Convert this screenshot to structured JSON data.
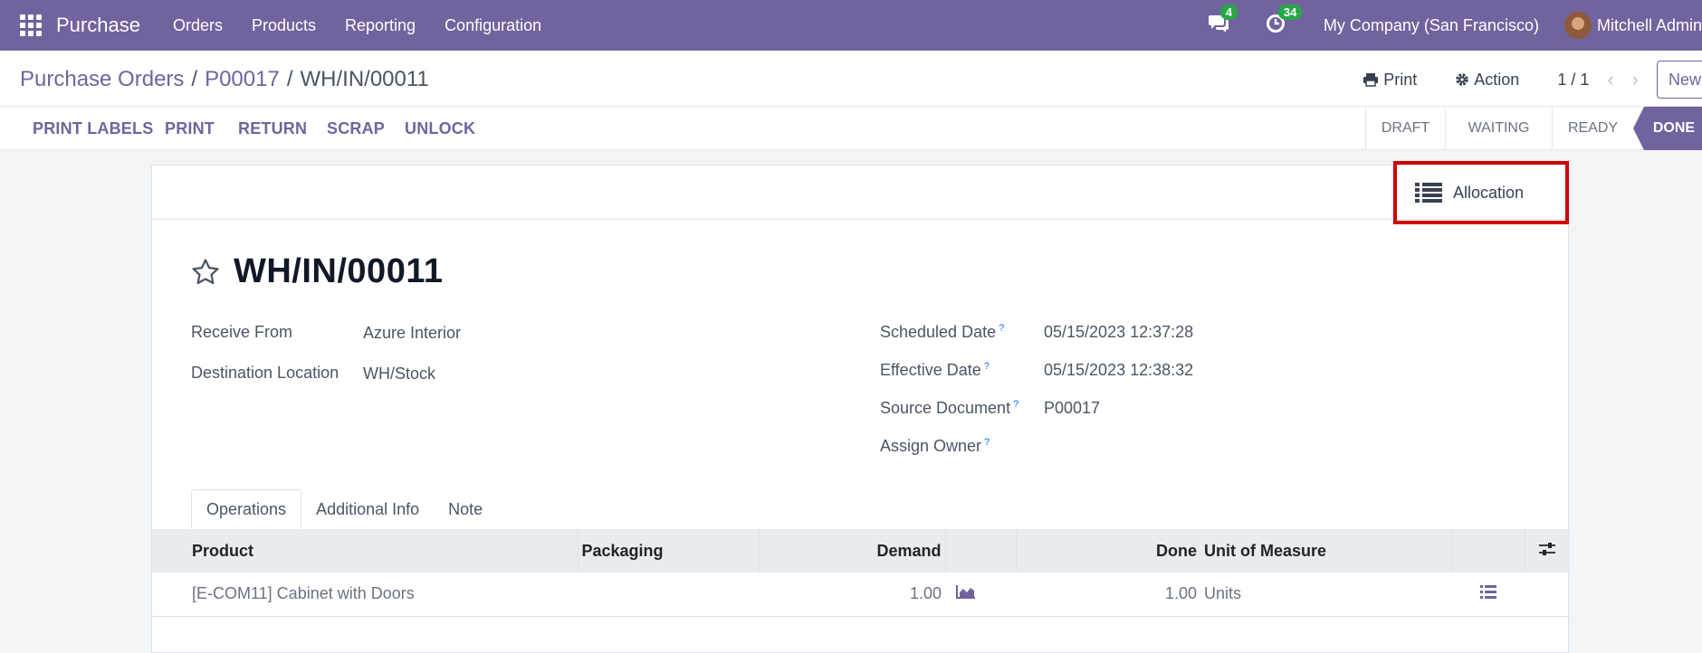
{
  "topnav": {
    "app_name": "Purchase",
    "menu": [
      "Orders",
      "Products",
      "Reporting",
      "Configuration"
    ],
    "messages_count": "4",
    "activities_count": "34",
    "company": "My Company (San Francisco)",
    "user": "Mitchell Admin"
  },
  "breadcrumb": {
    "items": [
      "Purchase Orders",
      "P00017"
    ],
    "current": "WH/IN/00011",
    "separator": "/"
  },
  "control": {
    "print_label": "Print",
    "action_label": "Action",
    "pager": "1 / 1",
    "new_label": "New"
  },
  "statusbar": {
    "buttons": [
      "PRINT LABELS",
      "PRINT",
      "RETURN",
      "SCRAP",
      "UNLOCK"
    ],
    "stages": [
      "DRAFT",
      "WAITING",
      "READY",
      "DONE"
    ],
    "active_stage": "DONE"
  },
  "smart_button": {
    "label": "Allocation"
  },
  "record": {
    "name": "WH/IN/00011",
    "receive_from_label": "Receive From",
    "receive_from": "Azure Interior",
    "destination_label": "Destination Location",
    "destination": "WH/Stock",
    "scheduled_label": "Scheduled Date",
    "scheduled": "05/15/2023 12:37:28",
    "effective_label": "Effective Date",
    "effective": "05/15/2023 12:38:32",
    "source_label": "Source Document",
    "source": "P00017",
    "owner_label": "Assign Owner",
    "help_mark": "?"
  },
  "tabs": [
    "Operations",
    "Additional Info",
    "Note"
  ],
  "table": {
    "headers": [
      "Product",
      "Packaging",
      "Demand",
      "Done",
      "Unit of Measure"
    ],
    "rows": [
      {
        "product": "[E-COM11] Cabinet with Doors",
        "packaging": "",
        "demand": "1.00",
        "done": "1.00",
        "uom": "Units"
      }
    ]
  },
  "colors": {
    "brand": "#71639e",
    "highlight": "#d00000",
    "badge": "#28a745"
  }
}
